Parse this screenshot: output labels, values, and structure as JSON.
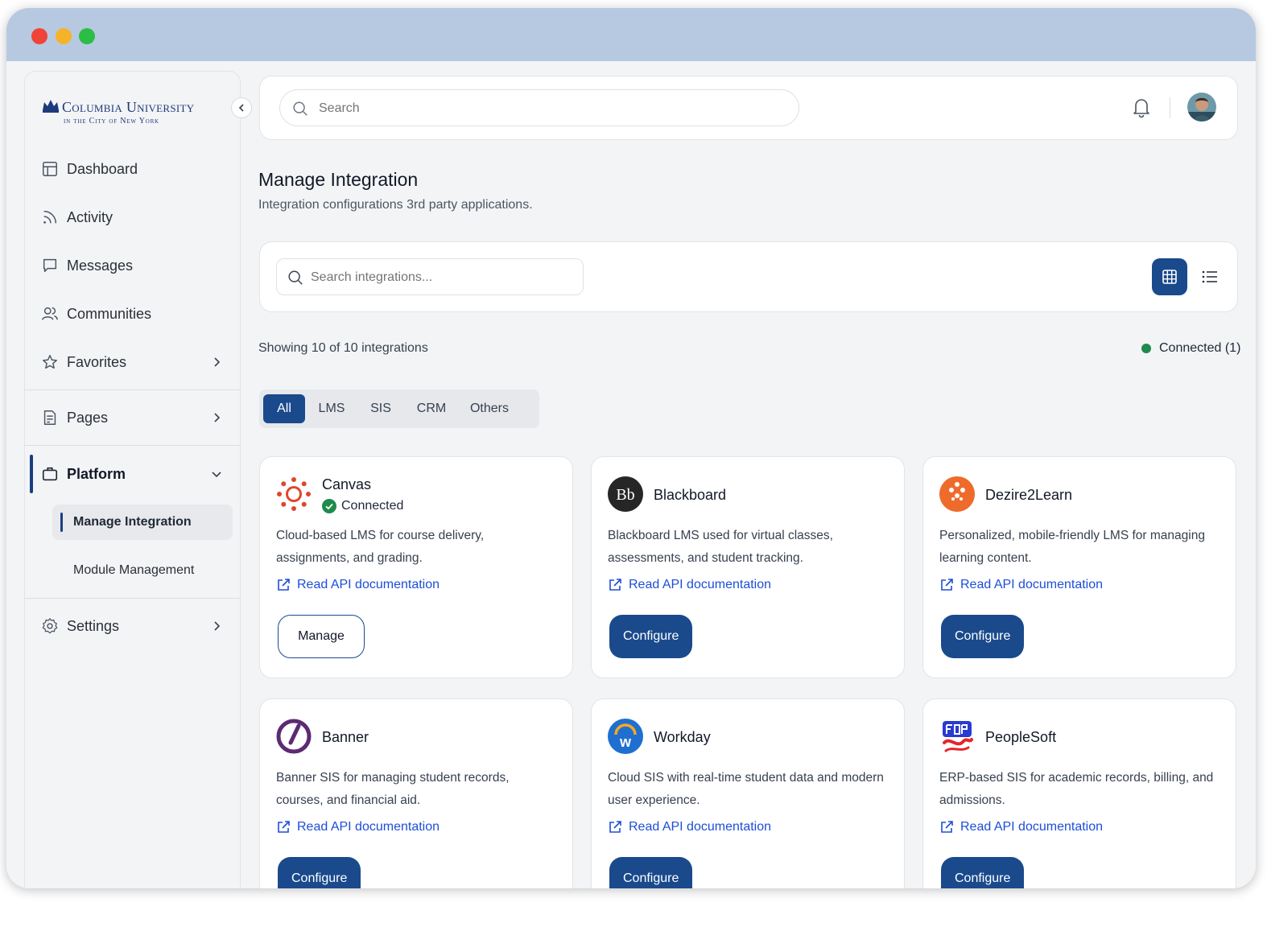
{
  "brand": {
    "name": "Columbia University",
    "subtitle": "in the City of New York",
    "color": "#1d3a7a"
  },
  "colors": {
    "accent": "#1a4a8c",
    "connected": "#1f8a4c",
    "link": "#1d4ed8"
  },
  "sidebar": {
    "items": [
      {
        "label": "Dashboard",
        "icon": "layout-icon"
      },
      {
        "label": "Activity",
        "icon": "rss-icon"
      },
      {
        "label": "Messages",
        "icon": "message-icon"
      },
      {
        "label": "Communities",
        "icon": "users-icon"
      },
      {
        "label": "Favorites",
        "icon": "star-icon"
      },
      {
        "label": "Pages",
        "icon": "file-icon"
      },
      {
        "label": "Platform",
        "icon": "briefcase-icon"
      },
      {
        "label": "Settings",
        "icon": "gear-icon"
      }
    ],
    "platform_sub": [
      {
        "label": "Manage Integration",
        "active": true
      },
      {
        "label": "Module Management",
        "active": false
      }
    ]
  },
  "topbar": {
    "search_placeholder": "Search"
  },
  "page": {
    "title": "Manage Integration",
    "subtitle": "Integration configurations 3rd party applications."
  },
  "filters": {
    "search_placeholder": "Search integrations...",
    "showing": "Showing 10 of 10 integrations",
    "connected_label": "Connected (1)",
    "tabs": [
      "All",
      "LMS",
      "SIS",
      "CRM",
      "Others"
    ],
    "active_tab": "All"
  },
  "cards": [
    {
      "name": "Canvas",
      "status": "Connected",
      "desc": "Cloud-based LMS for course delivery, assignments, and grading.",
      "link": "Read API documentation",
      "action": "Manage"
    },
    {
      "name": "Blackboard",
      "desc": "Blackboard LMS used for virtual classes, assessments, and student tracking.",
      "link": "Read API documentation",
      "action": "Configure"
    },
    {
      "name": "Dezire2Learn",
      "desc": "Personalized, mobile-friendly LMS for managing learning content.",
      "link": "Read API documentation",
      "action": "Configure"
    },
    {
      "name": "Banner",
      "desc": "Banner SIS for managing student records, courses, and financial aid.",
      "link": "Read API documentation",
      "action": "Configure"
    },
    {
      "name": "Workday",
      "desc": "Cloud SIS with real-time student data and modern user experience.",
      "link": "Read API documentation",
      "action": "Configure"
    },
    {
      "name": "PeopleSoft",
      "desc": "ERP-based SIS for academic records, billing, and admissions.",
      "link": "Read API documentation",
      "action": "Configure"
    }
  ]
}
